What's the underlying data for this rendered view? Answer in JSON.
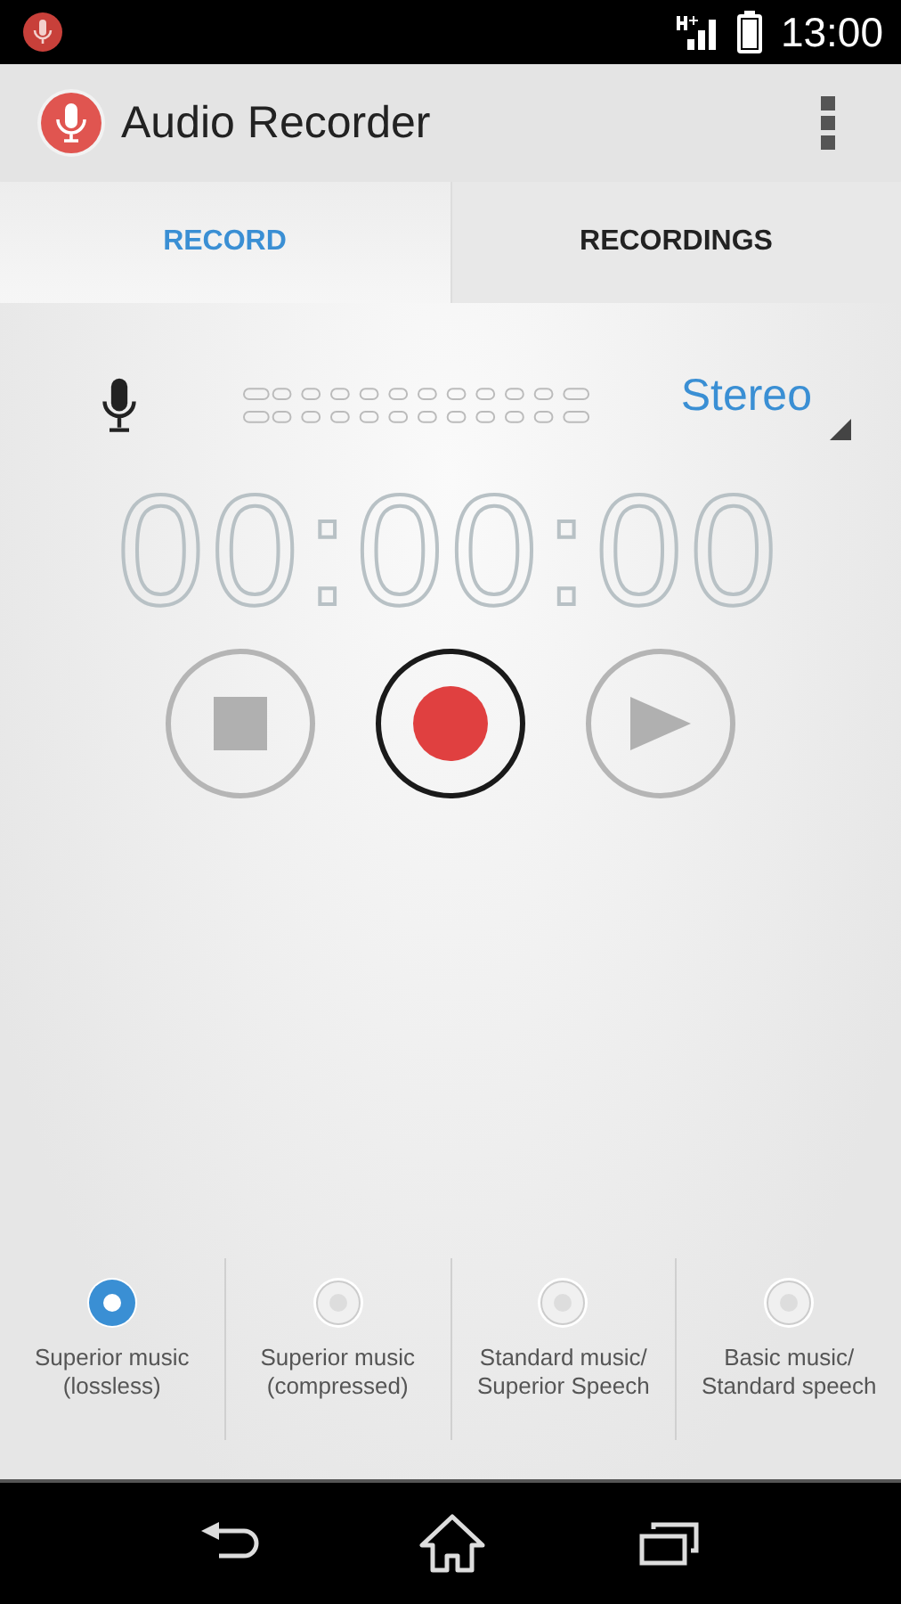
{
  "status_bar": {
    "time": "13:00"
  },
  "app_bar": {
    "title": "Audio Recorder"
  },
  "tabs": [
    {
      "label": "RECORD",
      "selected": true
    },
    {
      "label": "RECORDINGS",
      "selected": false
    }
  ],
  "channel_mode": "Stereo",
  "timer": "00:00:00",
  "controls": [
    {
      "kind": "stop",
      "disabled": true
    },
    {
      "kind": "record",
      "disabled": false
    },
    {
      "kind": "play",
      "disabled": true
    }
  ],
  "quality_options": [
    {
      "label": "Superior music\n(lossless)",
      "selected": true
    },
    {
      "label": "Superior music\n(compressed)",
      "selected": false
    },
    {
      "label": "Standard music/\nSuperior Speech",
      "selected": false
    },
    {
      "label": "Basic music/\nStandard speech",
      "selected": false
    }
  ]
}
